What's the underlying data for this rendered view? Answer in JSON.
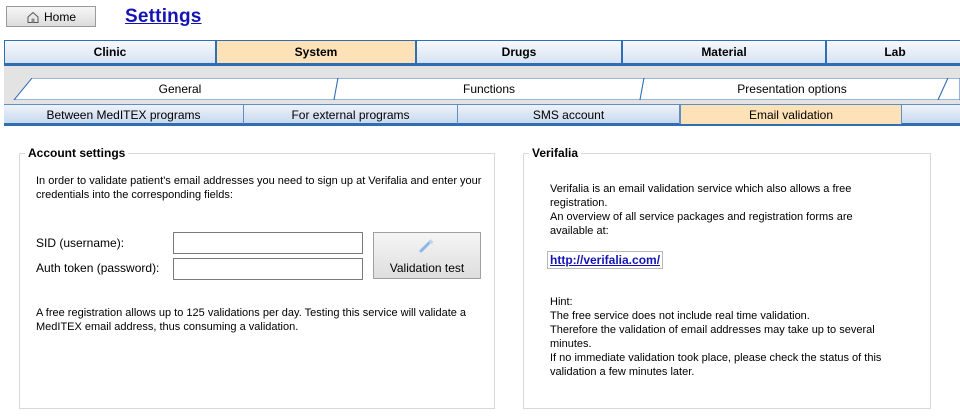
{
  "header": {
    "home_label": "Home",
    "home_icon": "home-icon",
    "title": "Settings"
  },
  "main_tabs": [
    {
      "label": "Clinic",
      "active": false
    },
    {
      "label": "System",
      "active": true
    },
    {
      "label": "Drugs",
      "active": false
    },
    {
      "label": "Material",
      "active": false
    },
    {
      "label": "Lab",
      "active": false
    }
  ],
  "sub_tabs_row1": [
    {
      "label": "General"
    },
    {
      "label": "Functions"
    },
    {
      "label": "Presentation options"
    }
  ],
  "sub_tabs_row2": [
    {
      "label": "Between MedITEX programs",
      "active": false
    },
    {
      "label": "For external programs",
      "active": false
    },
    {
      "label": "SMS account",
      "active": false
    },
    {
      "label": "Email validation",
      "active": true
    }
  ],
  "account": {
    "legend": "Account settings",
    "intro_line1": "In order to validate patient's email addresses you need to sign up at Verifalia and enter your",
    "intro_line2": "credentials into the corresponding fields:",
    "sid_label": "SID (username):",
    "sid_value": "",
    "token_label": "Auth token (password):",
    "token_value": "",
    "validate_button": "Validation test",
    "validate_icon": "test-wand-icon",
    "note_line1": "A free registration allows up to 125 validations per day. Testing this service will validate a",
    "note_line2": "MedITEX email address, thus consuming a validation."
  },
  "verifalia": {
    "legend": "Verifalia",
    "desc_line1": "Verifalia is an email validation service which also allows a free",
    "desc_line2": "registration.",
    "desc_line3": "An overview of all service packages and registration forms are",
    "desc_line4": "available at:",
    "link": "http://verifalia.com/",
    "hint_title": "Hint:",
    "hint_line1": "The free service does not include real time validation.",
    "hint_line2": "Therefore the validation of email addresses may take up to several",
    "hint_line3": "minutes.",
    "hint_line4": "If no immediate validation took place, please check the status of this",
    "hint_line5": "validation a few minutes later."
  },
  "colors": {
    "accent_blue": "#2f6db5",
    "active_tab": "#fde2b8",
    "title_link": "#1414b4"
  }
}
